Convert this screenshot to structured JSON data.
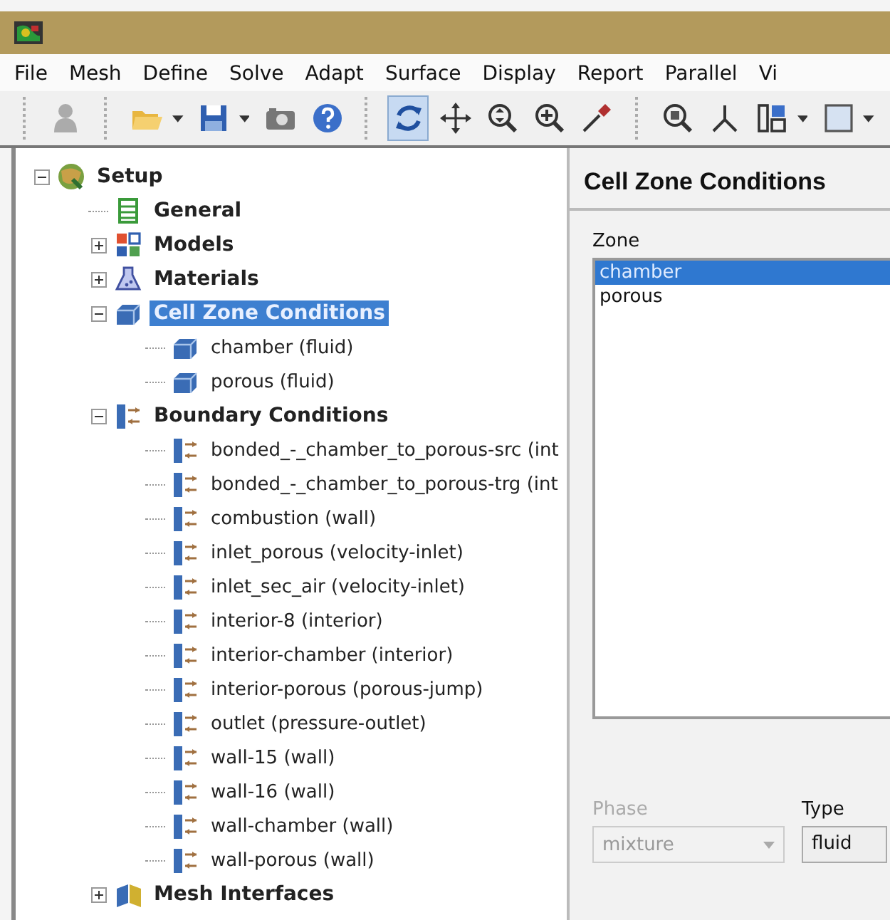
{
  "menu": [
    "File",
    "Mesh",
    "Define",
    "Solve",
    "Adapt",
    "Surface",
    "Display",
    "Report",
    "Parallel",
    "Vi"
  ],
  "toolbar": [
    [
      {
        "kind": "figure",
        "disabled": true,
        "selected": false,
        "dropdown": false
      }
    ],
    [
      {
        "kind": "open",
        "disabled": false,
        "selected": false,
        "dropdown": true
      },
      {
        "kind": "save",
        "disabled": false,
        "selected": false,
        "dropdown": true
      },
      {
        "kind": "camera",
        "disabled": false,
        "selected": false,
        "dropdown": false
      },
      {
        "kind": "help",
        "disabled": false,
        "selected": false,
        "dropdown": false
      }
    ],
    [
      {
        "kind": "rotate",
        "disabled": false,
        "selected": true,
        "dropdown": false
      },
      {
        "kind": "pan",
        "disabled": false,
        "selected": false,
        "dropdown": false
      },
      {
        "kind": "zoomfit",
        "disabled": false,
        "selected": false,
        "dropdown": false
      },
      {
        "kind": "zoomin",
        "disabled": false,
        "selected": false,
        "dropdown": false
      },
      {
        "kind": "probe",
        "disabled": false,
        "selected": false,
        "dropdown": false
      }
    ],
    [
      {
        "kind": "fit",
        "disabled": false,
        "selected": false,
        "dropdown": false
      },
      {
        "kind": "axes",
        "disabled": false,
        "selected": false,
        "dropdown": false
      },
      {
        "kind": "layout",
        "disabled": false,
        "selected": false,
        "dropdown": true
      },
      {
        "kind": "square",
        "disabled": false,
        "selected": false,
        "dropdown": true
      }
    ]
  ],
  "tree": [
    {
      "label": "Setup",
      "kind": "setup",
      "expanded": true,
      "selected": false,
      "children": [
        {
          "label": "General",
          "kind": "general",
          "selected": false
        },
        {
          "label": "Models",
          "kind": "models",
          "expanded": false,
          "selected": false
        },
        {
          "label": "Materials",
          "kind": "materials",
          "expanded": false,
          "selected": false
        },
        {
          "label": "Cell Zone Conditions",
          "kind": "cellzones",
          "expanded": true,
          "selected": true,
          "children": [
            {
              "label": "chamber (fluid)",
              "kind": "zone",
              "selected": false
            },
            {
              "label": "porous (fluid)",
              "kind": "zone",
              "selected": false
            }
          ]
        },
        {
          "label": "Boundary Conditions",
          "kind": "boundaries",
          "expanded": true,
          "selected": false,
          "children": [
            {
              "label": "bonded_-_chamber_to_porous-src (int",
              "kind": "boundary",
              "selected": false
            },
            {
              "label": "bonded_-_chamber_to_porous-trg (int",
              "kind": "boundary",
              "selected": false
            },
            {
              "label": "combustion (wall)",
              "kind": "boundary",
              "selected": false
            },
            {
              "label": "inlet_porous (velocity-inlet)",
              "kind": "boundary",
              "selected": false
            },
            {
              "label": "inlet_sec_air (velocity-inlet)",
              "kind": "boundary",
              "selected": false
            },
            {
              "label": "interior-8 (interior)",
              "kind": "boundary",
              "selected": false
            },
            {
              "label": "interior-chamber (interior)",
              "kind": "boundary",
              "selected": false
            },
            {
              "label": "interior-porous (porous-jump)",
              "kind": "boundary",
              "selected": false
            },
            {
              "label": "outlet (pressure-outlet)",
              "kind": "boundary",
              "selected": false
            },
            {
              "label": "wall-15 (wall)",
              "kind": "boundary",
              "selected": false
            },
            {
              "label": "wall-16 (wall)",
              "kind": "boundary",
              "selected": false
            },
            {
              "label": "wall-chamber (wall)",
              "kind": "boundary",
              "selected": false
            },
            {
              "label": "wall-porous (wall)",
              "kind": "boundary",
              "selected": false
            }
          ]
        },
        {
          "label": "Mesh Interfaces",
          "kind": "interfaces",
          "expanded": false,
          "selected": false
        }
      ]
    }
  ],
  "panel": {
    "title": "Cell Zone Conditions",
    "zone_label": "Zone",
    "zones": [
      {
        "label": "chamber",
        "selected": true
      },
      {
        "label": "porous",
        "selected": false
      }
    ],
    "phase": {
      "label": "Phase",
      "value": "mixture",
      "disabled": true
    },
    "type": {
      "label": "Type",
      "value": "fluid"
    }
  }
}
